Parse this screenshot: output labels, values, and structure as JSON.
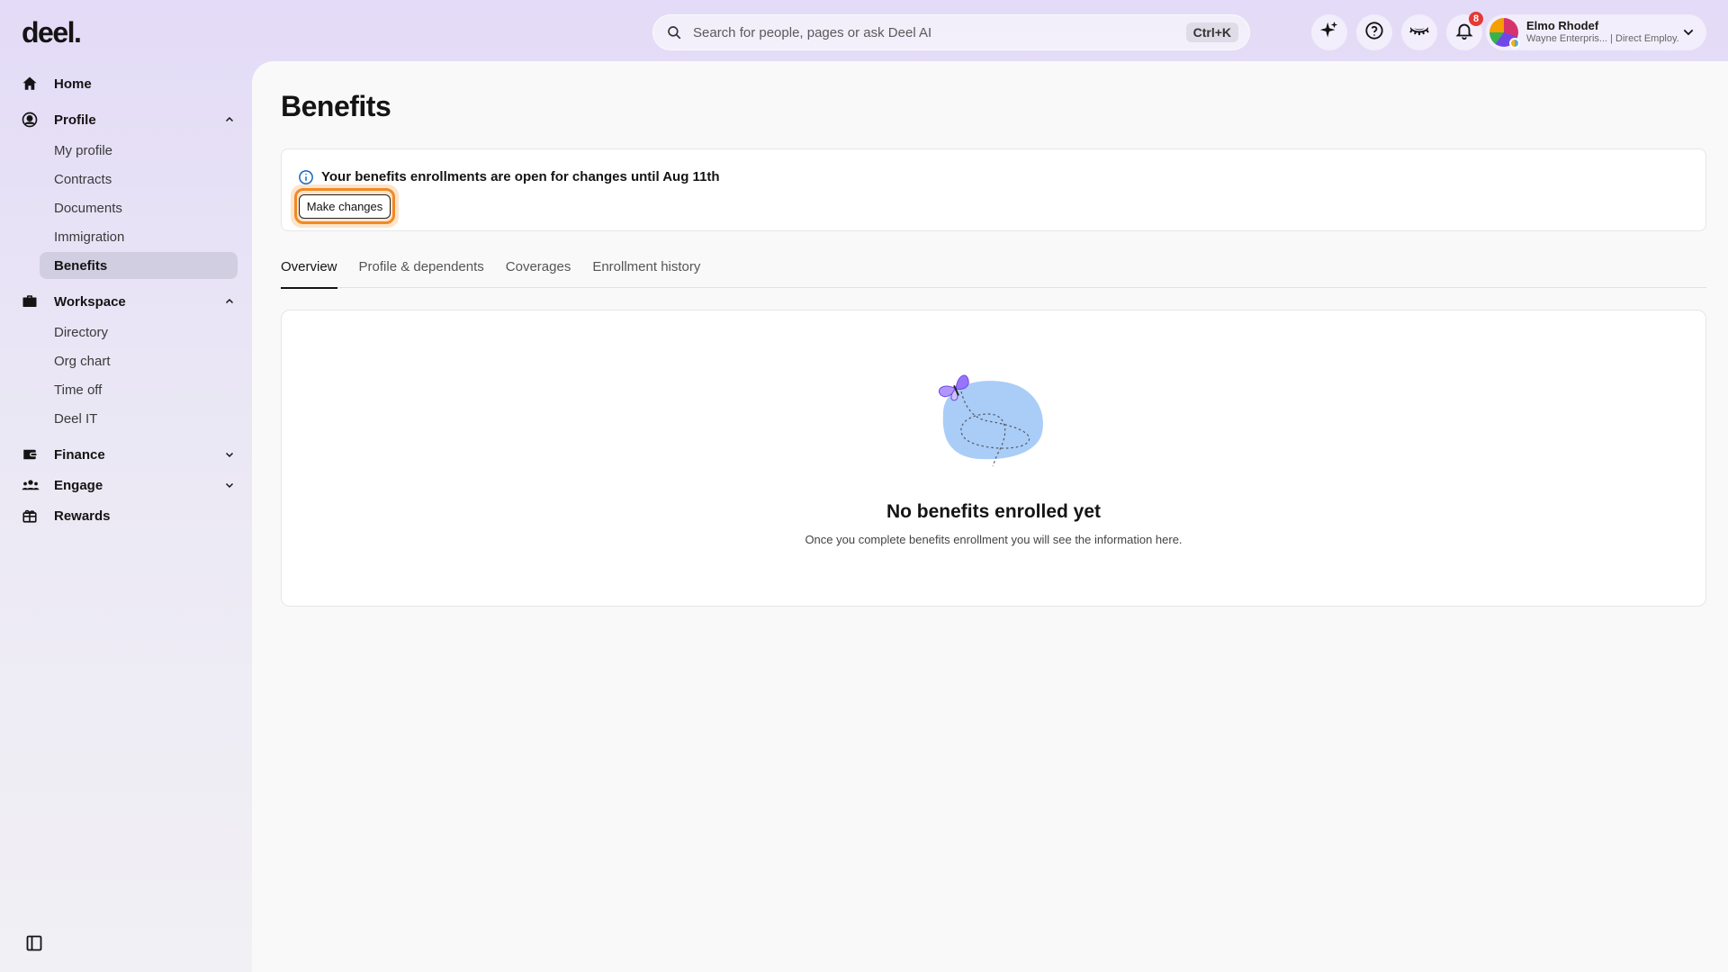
{
  "app": {
    "logo": "deel."
  },
  "search": {
    "placeholder": "Search for people, pages or ask Deel AI",
    "shortcut": "Ctrl+K"
  },
  "topbar": {
    "icons": [
      "sparkle-icon",
      "help-icon",
      "eye-closed-icon",
      "bell-icon"
    ],
    "notification_count": "8"
  },
  "user": {
    "name": "Elmo Rhodef",
    "subtitle": "Wayne Enterpris... | Direct Employ..."
  },
  "sidebar": {
    "home": "Home",
    "profile": {
      "label": "Profile",
      "items": [
        "My profile",
        "Contracts",
        "Documents",
        "Immigration",
        "Benefits"
      ],
      "active": "Benefits"
    },
    "workspace": {
      "label": "Workspace",
      "items": [
        "Directory",
        "Org chart",
        "Time off",
        "Deel IT"
      ]
    },
    "finance": "Finance",
    "engage": "Engage",
    "rewards": "Rewards"
  },
  "main": {
    "title": "Benefits",
    "notice": {
      "text": "Your benefits enrollments are open for changes until Aug 11th",
      "button": "Make changes"
    },
    "tabs": [
      "Overview",
      "Profile & dependents",
      "Coverages",
      "Enrollment history"
    ],
    "active_tab": "Overview",
    "empty_state": {
      "title": "No benefits enrolled yet",
      "subtitle": "Once you complete benefits enrollment you will see the information here."
    }
  },
  "colors": {
    "accent_ring": "#f08a24",
    "illustration_blob": "#a9cdf7",
    "butterfly": "#9775fa"
  }
}
